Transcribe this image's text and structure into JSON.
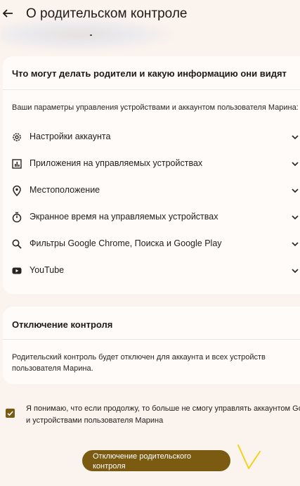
{
  "header": {
    "title": "О родительском контроле"
  },
  "section_what": {
    "title": "Что могут делать родители и какую информацию они видят",
    "description": "Ваши параметры управления устройствами и аккаунтом пользователя Марина:",
    "items": [
      {
        "label": "Настройки аккаунта",
        "icon": "gear-icon"
      },
      {
        "label": "Приложения на управляемых устройствах",
        "icon": "apps-chart-icon"
      },
      {
        "label": "Местоположение",
        "icon": "location-pin-icon"
      },
      {
        "label": "Экранное время на управляемых устройствах",
        "icon": "timer-icon"
      },
      {
        "label": "Фильтры Google Chrome, Поиска и Google Play",
        "icon": "search-icon"
      },
      {
        "label": "YouTube",
        "icon": "youtube-icon"
      }
    ]
  },
  "section_disable": {
    "title": "Отключение контроля",
    "description": "Родительский контроль будет отключен для аккаунта и всех устройств пользователя Марина."
  },
  "confirm": {
    "checked": true,
    "text_line1": "Я понимаю, что если продолжу, то больше не смогу управлять аккаунтом Goo",
    "text_line2": "и устройствами пользователя Марина"
  },
  "button": {
    "label": "Отключение родительского контроля"
  },
  "colors": {
    "background": "#fbf3ee",
    "card": "#fffbf9",
    "accent": "#7b5a12",
    "annotation": "#f2d21b"
  }
}
